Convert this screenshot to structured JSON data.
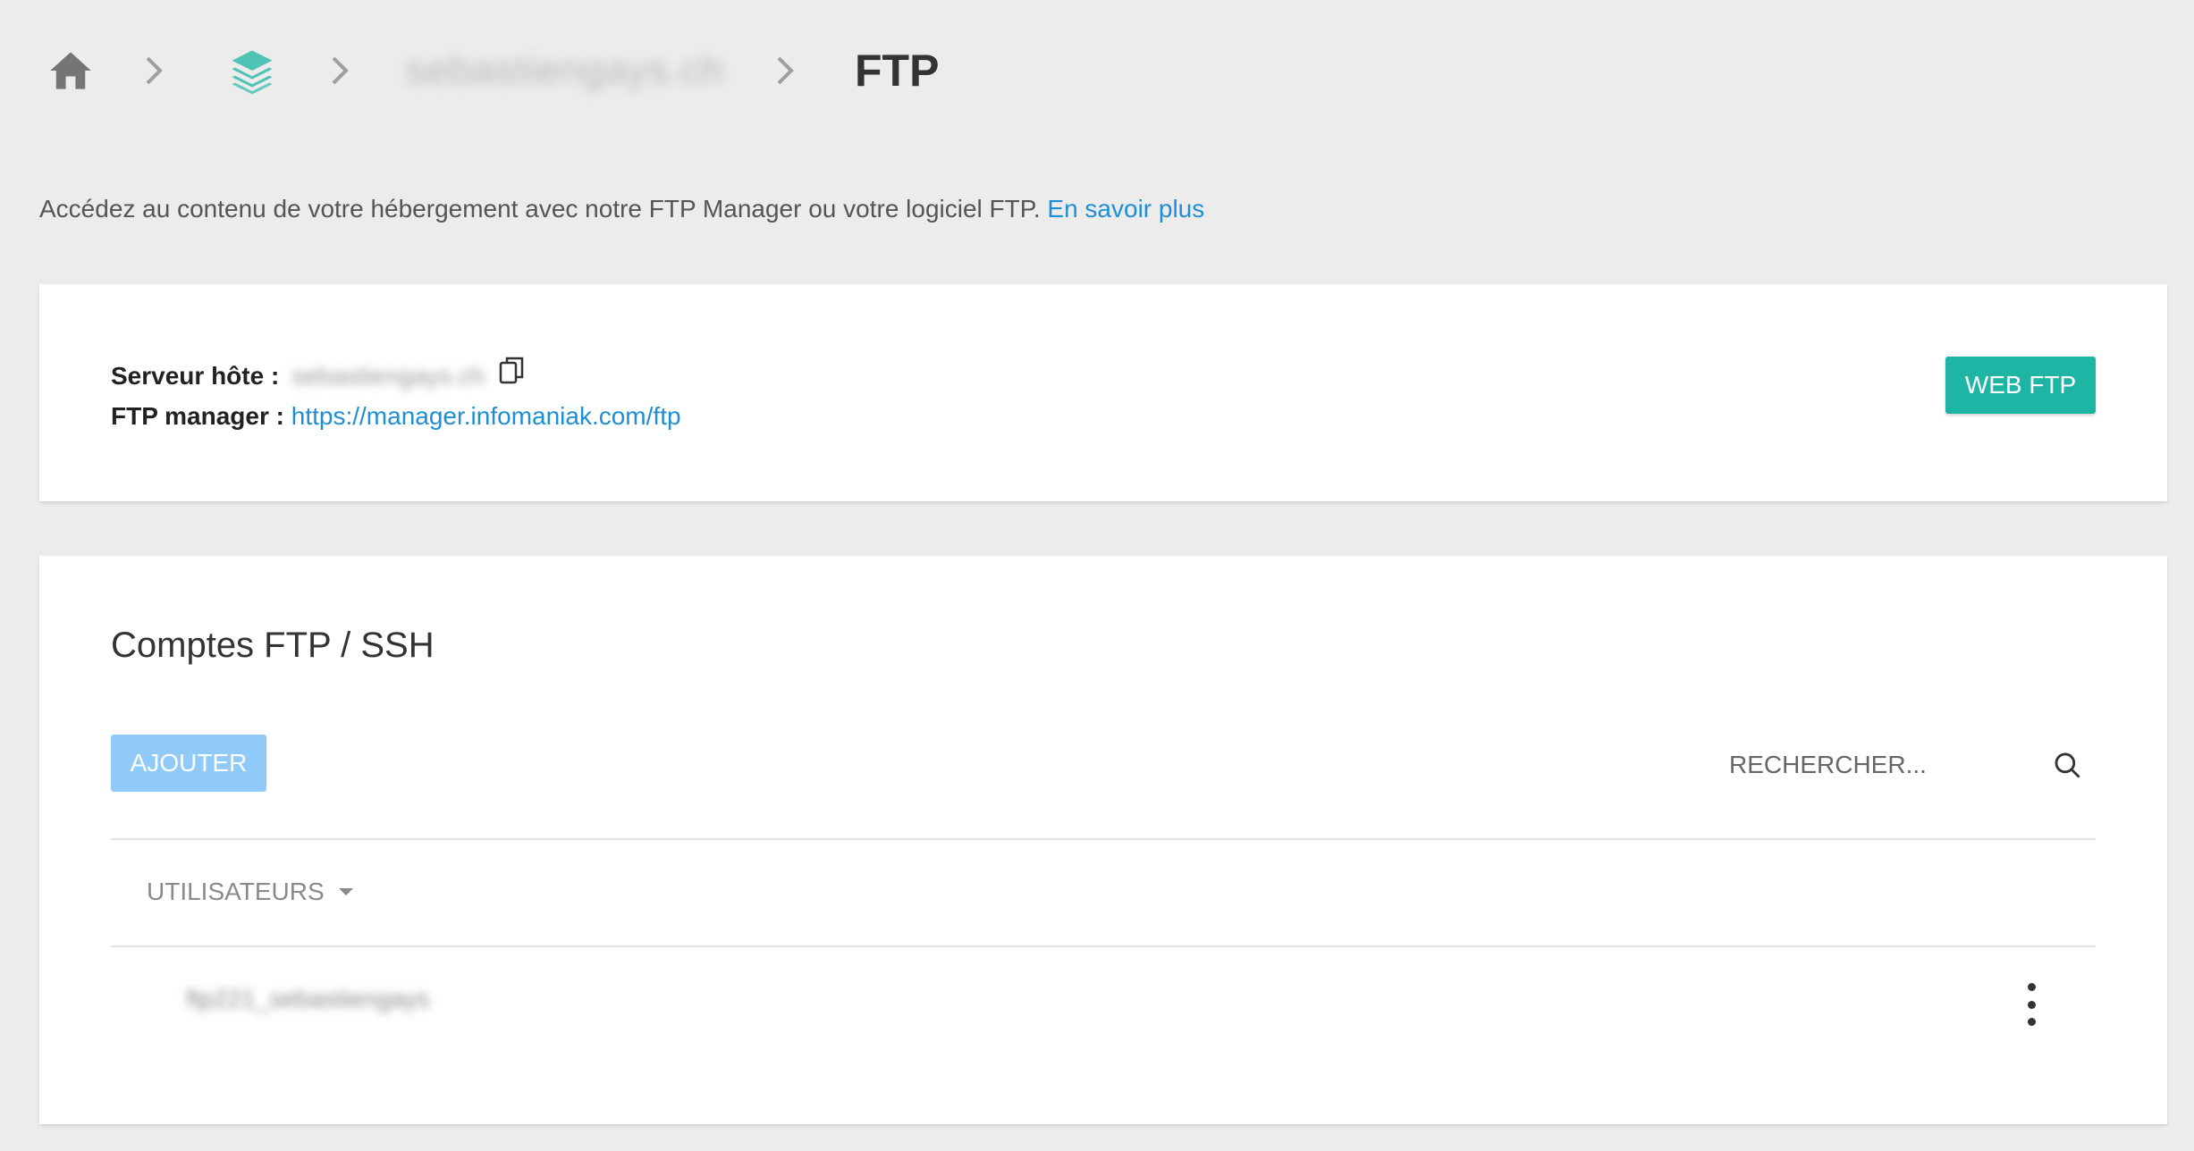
{
  "breadcrumb": {
    "home_icon": "home-icon",
    "product_icon": "layers-icon",
    "site_name": "sebastiengays.ch",
    "current": "FTP"
  },
  "intro": {
    "text": "Accédez au contenu de votre hébergement avec notre FTP Manager ou votre logiciel FTP. ",
    "link": "En savoir plus"
  },
  "host_card": {
    "server_label": "Serveur hôte :",
    "server_value": "sebastiengays.ch",
    "manager_label": "FTP manager :",
    "manager_url": "https://manager.infomaniak.com/ftp",
    "web_ftp_button": "WEB FTP"
  },
  "accounts": {
    "title": "Comptes FTP / SSH",
    "add_button": "AJOUTER",
    "search_placeholder": "RECHERCHER...",
    "column_header": "UTILISATEURS",
    "rows": [
      {
        "user": "ftp221_sebastiengays"
      }
    ]
  },
  "colors": {
    "background": "#ececec",
    "link": "#1e8fd6",
    "web_ftp_button": "#1fb5a4",
    "add_button": "#90caf9",
    "layers_icon": "#4fc3b4"
  }
}
